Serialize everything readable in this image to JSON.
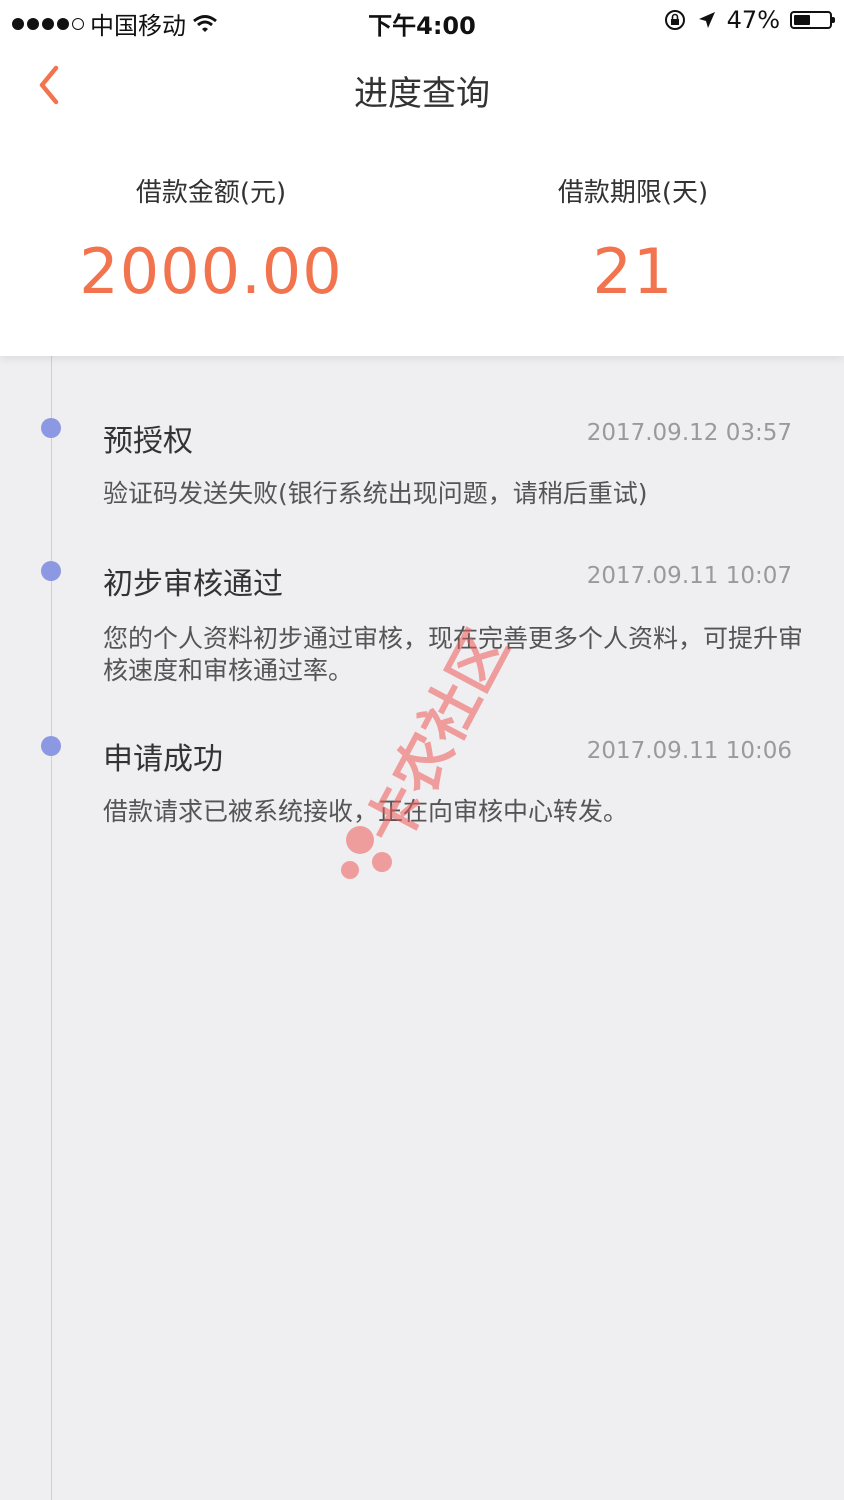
{
  "status_bar": {
    "carrier": "中国移动",
    "time": "下午4:00",
    "battery": "47%",
    "battery_level": 0.47
  },
  "nav": {
    "title": "进度查询",
    "back_icon": "chevron-left-icon"
  },
  "summary": {
    "amount_label": "借款金额(元)",
    "amount_value": "2000.00",
    "term_label": "借款期限(天)",
    "term_value": "21"
  },
  "timeline": [
    {
      "title": "预授权",
      "date": "2017.09.12 03:57",
      "desc": "验证码发送失败(银行系统出现问题，请稍后重试)"
    },
    {
      "title": "初步审核通过",
      "date": "2017.09.11 10:07",
      "desc": "您的个人资料初步通过审核，现在完善更多个人资料，可提升审核速度和审核通过率。"
    },
    {
      "title": "申请成功",
      "date": "2017.09.11 10:06",
      "desc": "借款请求已被系统接收，正在向审核中心转发。"
    }
  ],
  "watermark": {
    "text": "卡农社区"
  },
  "colors": {
    "accent": "#f2744e",
    "bullet": "#8d98e3",
    "background": "#efeff1"
  }
}
